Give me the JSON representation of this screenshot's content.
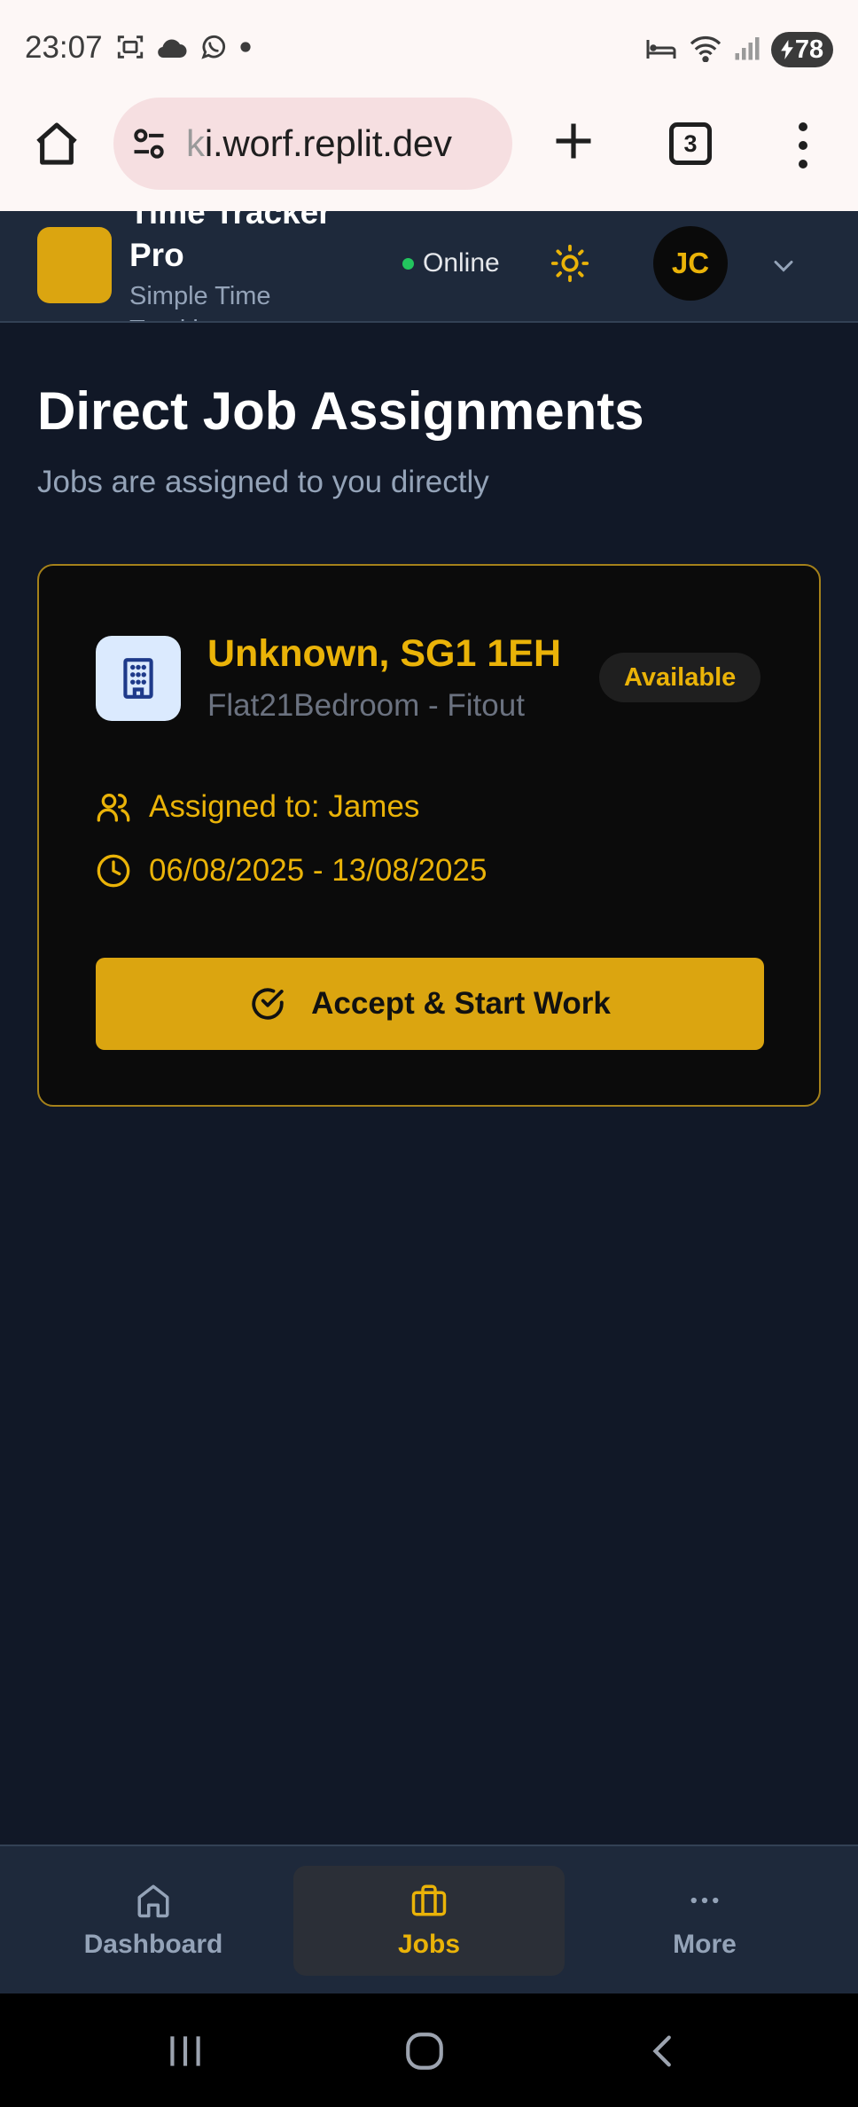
{
  "status_bar": {
    "time": "23:07",
    "battery": "78"
  },
  "browser": {
    "url_faded": "k",
    "url": "i.worf.replit.dev",
    "tab_count": "3"
  },
  "header": {
    "app_title": "Time Tracker Pro",
    "app_subtitle": "Simple Time Tracking",
    "online_label": "Online",
    "avatar_initials": "JC"
  },
  "page": {
    "title": "Direct Job Assignments",
    "subtitle": "Jobs are assigned to you directly"
  },
  "job": {
    "title": "Unknown, SG1 1EH",
    "subtitle": "Flat21Bedroom - Fitout",
    "status": "Available",
    "assigned": "Assigned to: James",
    "dates": "06/08/2025 - 13/08/2025",
    "action_label": "Accept & Start Work"
  },
  "nav": {
    "items": [
      {
        "label": "Dashboard",
        "icon": "home-icon"
      },
      {
        "label": "Jobs",
        "icon": "briefcase-icon"
      },
      {
        "label": "More",
        "icon": "more-horizontal-icon"
      }
    ],
    "active": "Jobs"
  },
  "colors": {
    "accent": "#eab308",
    "primary_button": "#dba510",
    "background": "#111827",
    "header": "#1e293b",
    "online": "#22c55e"
  }
}
